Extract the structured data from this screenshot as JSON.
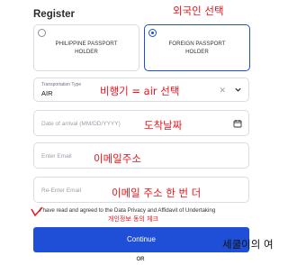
{
  "form": {
    "title": "Register",
    "passport_options": [
      {
        "label": "PHILIPPINE PASSPORT HOLDER",
        "selected": false
      },
      {
        "label": "FOREIGN PASSPORT HOLDER",
        "selected": true
      }
    ],
    "transport": {
      "label": "Transportation Type",
      "value": "AIR"
    },
    "arrival_date": {
      "placeholder": "Date of arrival (MM/DD/YYYY)"
    },
    "email": {
      "placeholder": "Enter Email"
    },
    "re_email": {
      "placeholder": "Re-Enter Email"
    },
    "agreement_text": "I have read and agreed to the Data Privacy and Affidavit of Undertaking",
    "continue_label": "Continue",
    "or_label": "OR"
  },
  "annotations": {
    "foreigner_select": "외국인 선택",
    "airplane_select": "비행기 = air 선택",
    "arrival_date": "도착날짜",
    "email": "이메일주소",
    "email_again": "이메일 주소 한 번 더",
    "privacy_check": "개인정보 동의 체크",
    "handwriting": "세쿨이의 여"
  },
  "colors": {
    "primary": "#1f4fd6",
    "annotation": "#e8141c"
  },
  "icons": {
    "clear": "close-icon",
    "dropdown": "chevron-down-icon",
    "calendar": "calendar-icon"
  }
}
